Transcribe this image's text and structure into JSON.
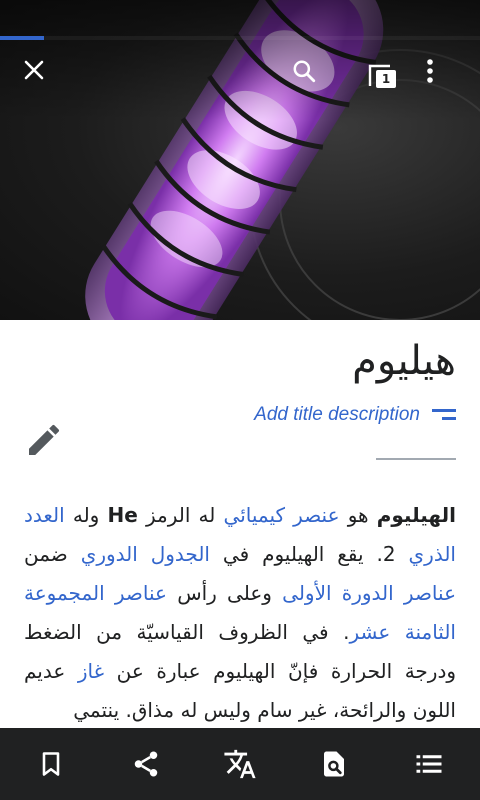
{
  "toolbar": {
    "tab_count": "1"
  },
  "article": {
    "title": "هيليوم",
    "description_link": "Add title description",
    "body": {
      "s1": "الهيليوم",
      "s2": " هو ",
      "s3": "عنصر كيميائي",
      "s4": " له الرمز ",
      "s5": "He",
      "s6": " وله ",
      "s7": "العدد الذري",
      "s8": " 2. يقع الهيليوم في ",
      "s9": "الجدول الدوري",
      "s10": " ضمن ",
      "s11": "عناصر الدورة الأولى",
      "s12": " وعلى رأس ",
      "s13": "عناصر المجموعة الثامنة عشر",
      "s14": ". في الظروف القياسيّة من الضغط ودرجة الحرارة فإنّ الهيليوم عبارة عن ",
      "s15": "غاز",
      "s16": " عديم اللون والرائحة، غير سام وليس له مذاق. ينتمي"
    }
  },
  "colors": {
    "link": "#3366cc",
    "bar": "#202122",
    "text": "#202122"
  },
  "icons": {
    "top": [
      "close-icon",
      "search-icon",
      "tabs-icon",
      "overflow-menu-icon"
    ],
    "edit": "pencil-icon",
    "bottom": [
      "bookmark-icon",
      "share-icon",
      "translate-icon",
      "find-in-page-icon",
      "contents-icon"
    ]
  }
}
